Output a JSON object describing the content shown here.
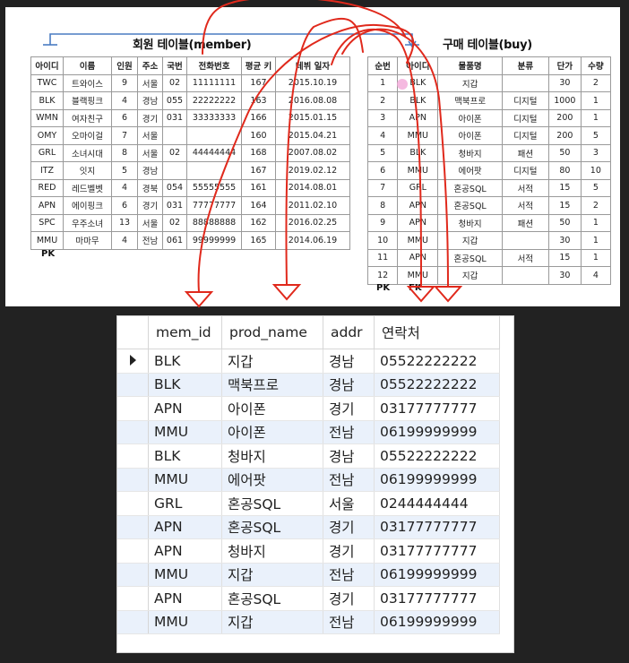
{
  "member_table": {
    "title": "회원 테이블(member)",
    "headers": [
      "아이디",
      "이름",
      "인원",
      "주소",
      "국번",
      "전화번호",
      "평균 키",
      "데뷔 일자"
    ],
    "rows": [
      [
        "TWC",
        "트와이스",
        "9",
        "서울",
        "02",
        "11111111",
        "167",
        "2015.10.19"
      ],
      [
        "BLK",
        "블랙핑크",
        "4",
        "경남",
        "055",
        "22222222",
        "163",
        "2016.08.08"
      ],
      [
        "WMN",
        "여자친구",
        "6",
        "경기",
        "031",
        "33333333",
        "166",
        "2015.01.15"
      ],
      [
        "OMY",
        "오마이걸",
        "7",
        "서울",
        "",
        "",
        "160",
        "2015.04.21"
      ],
      [
        "GRL",
        "소녀시대",
        "8",
        "서울",
        "02",
        "44444444",
        "168",
        "2007.08.02"
      ],
      [
        "ITZ",
        "잇지",
        "5",
        "경남",
        "",
        "",
        "167",
        "2019.02.12"
      ],
      [
        "RED",
        "레드벨벳",
        "4",
        "경북",
        "054",
        "55555555",
        "161",
        "2014.08.01"
      ],
      [
        "APN",
        "에이핑크",
        "6",
        "경기",
        "031",
        "77777777",
        "164",
        "2011.02.10"
      ],
      [
        "SPC",
        "우주소녀",
        "13",
        "서울",
        "02",
        "88888888",
        "162",
        "2016.02.25"
      ],
      [
        "MMU",
        "마마무",
        "4",
        "전남",
        "061",
        "99999999",
        "165",
        "2014.06.19"
      ]
    ],
    "pk_label": "PK"
  },
  "buy_table": {
    "title": "구매 테이블(buy)",
    "headers": [
      "순번",
      "아이디",
      "물품명",
      "분류",
      "단가",
      "수량"
    ],
    "rows": [
      [
        "1",
        "BLK",
        "지갑",
        "",
        "30",
        "2"
      ],
      [
        "2",
        "BLK",
        "맥북프로",
        "디지털",
        "1000",
        "1"
      ],
      [
        "3",
        "APN",
        "아이폰",
        "디지털",
        "200",
        "1"
      ],
      [
        "4",
        "MMU",
        "아이폰",
        "디지털",
        "200",
        "5"
      ],
      [
        "5",
        "BLK",
        "청바지",
        "패션",
        "50",
        "3"
      ],
      [
        "6",
        "MMU",
        "에어팟",
        "디지털",
        "80",
        "10"
      ],
      [
        "7",
        "GRL",
        "혼공SQL",
        "서적",
        "15",
        "5"
      ],
      [
        "8",
        "APN",
        "혼공SQL",
        "서적",
        "15",
        "2"
      ],
      [
        "9",
        "APN",
        "청바지",
        "패션",
        "50",
        "1"
      ],
      [
        "10",
        "MMU",
        "지갑",
        "",
        "30",
        "1"
      ],
      [
        "11",
        "APN",
        "혼공SQL",
        "서적",
        "15",
        "1"
      ],
      [
        "12",
        "MMU",
        "지갑",
        "",
        "30",
        "4"
      ]
    ],
    "pk_label": "PK",
    "fk_label": "FK"
  },
  "result_grid": {
    "columns": [
      "mem_id",
      "prod_name",
      "addr",
      "연락처"
    ],
    "rows": [
      [
        "BLK",
        "지갑",
        "경남",
        "05522222222"
      ],
      [
        "BLK",
        "맥북프로",
        "경남",
        "05522222222"
      ],
      [
        "APN",
        "아이폰",
        "경기",
        "03177777777"
      ],
      [
        "MMU",
        "아이폰",
        "전남",
        "06199999999"
      ],
      [
        "BLK",
        "청바지",
        "경남",
        "05522222222"
      ],
      [
        "MMU",
        "에어팟",
        "전남",
        "06199999999"
      ],
      [
        "GRL",
        "혼공SQL",
        "서울",
        "0244444444"
      ],
      [
        "APN",
        "혼공SQL",
        "경기",
        "03177777777"
      ],
      [
        "APN",
        "청바지",
        "경기",
        "03177777777"
      ],
      [
        "MMU",
        "지갑",
        "전남",
        "06199999999"
      ],
      [
        "APN",
        "혼공SQL",
        "경기",
        "03177777777"
      ],
      [
        "MMU",
        "지갑",
        "전남",
        "06199999999"
      ]
    ],
    "current_row_index": 0
  },
  "colors": {
    "annotation_red": "#e0291c",
    "relation_line": "#4a7cc2",
    "alt_row": "#eaf1fb"
  }
}
